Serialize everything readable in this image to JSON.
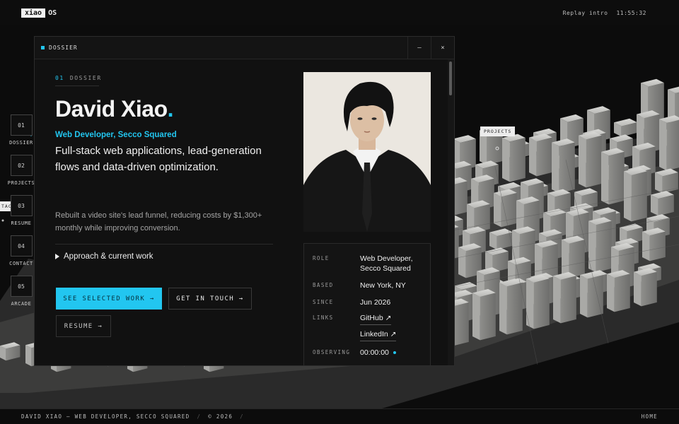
{
  "topbar": {
    "logo_box": "xiao",
    "logo_text": "OS",
    "replay": "Replay intro",
    "clock": "11:55:32"
  },
  "nav": [
    {
      "num": "01",
      "label": "DOSSIER"
    },
    {
      "num": "02",
      "label": "PROJECTS"
    },
    {
      "num": "03",
      "label": "RESUME"
    },
    {
      "num": "04",
      "label": "CONTACT"
    },
    {
      "num": "05",
      "label": "ARCADE"
    }
  ],
  "scene": {
    "projects_tag": "PROJECTS",
    "contact_tag": "TACT"
  },
  "window": {
    "title": "DOSSIER",
    "minimize": "–",
    "close": "×",
    "eyebrow_num": "01",
    "eyebrow_label": "DOSSIER",
    "name": "David Xiao",
    "name_dot": ".",
    "role": "Web Developer, Secco Squared",
    "headline": "Full-stack web applications, lead-generation flows and data-driven optimization.",
    "description": "Rebuilt a video site's lead funnel, reducing costs by $1,300+ monthly while improving conversion.",
    "approach": "Approach & current work",
    "btn_work": "SEE SELECTED WORK →",
    "btn_touch": "GET IN TOUCH →",
    "btn_resume": "RESUME →",
    "info": {
      "role_key": "ROLE",
      "role_line1": "Web Developer,",
      "role_line2": "Secco Squared",
      "based_key": "BASED",
      "based_val": "New York, NY",
      "since_key": "SINCE",
      "since_val": "Jun 2026",
      "links_key": "LINKS",
      "link_github": "GitHub ↗",
      "link_linkedin": "LinkedIn ↗",
      "observing_key": "OBSERVING",
      "observing_val": "00:00:00"
    }
  },
  "footer": {
    "left": "DAVID XIAO — WEB DEVELOPER, SECCO SQUARED",
    "sep1": "/",
    "year": "© 2026",
    "sep2": "/",
    "right": "HOME"
  },
  "colors": {
    "accent": "#22c6f0",
    "background": "#0d0d0d",
    "panel": "#111111"
  }
}
